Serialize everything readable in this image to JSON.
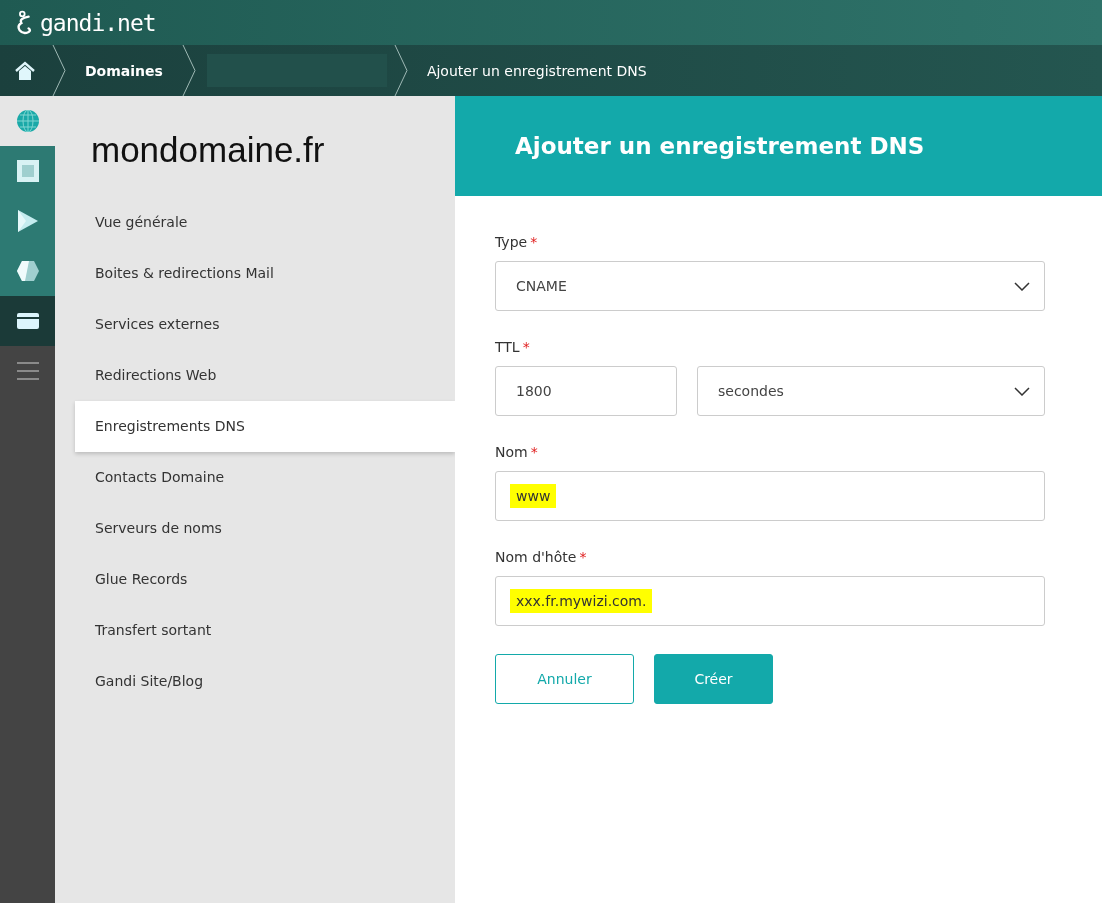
{
  "header": {
    "logo_text": "gandi.net"
  },
  "breadcrumb": [
    {
      "kind": "home"
    },
    {
      "kind": "text",
      "label": "Domaines",
      "bold": true
    },
    {
      "kind": "redacted"
    },
    {
      "kind": "text",
      "label": "Ajouter un enregistrement DNS",
      "bold": false
    }
  ],
  "sidebar": {
    "title": "mondomaine.fr",
    "items": [
      {
        "label": "Vue générale",
        "selected": false
      },
      {
        "label": "Boites & redirections Mail",
        "selected": false
      },
      {
        "label": "Services externes",
        "selected": false
      },
      {
        "label": "Redirections Web",
        "selected": false
      },
      {
        "label": "Enregistrements DNS",
        "selected": true
      },
      {
        "label": "Contacts Domaine",
        "selected": false
      },
      {
        "label": "Serveurs de noms",
        "selected": false
      },
      {
        "label": "Glue Records",
        "selected": false
      },
      {
        "label": "Transfert sortant",
        "selected": false
      },
      {
        "label": "Gandi Site/Blog",
        "selected": false
      }
    ]
  },
  "panel": {
    "title": "Ajouter un enregistrement DNS",
    "fields": [
      {
        "kind": "select",
        "label": "Type",
        "required_mark": "*",
        "value": "CNAME",
        "highlighted": false
      },
      {
        "kind": "pair",
        "label": "TTL",
        "required_mark": "*",
        "value": "1800",
        "unit": "secondes",
        "highlighted": false
      },
      {
        "kind": "input",
        "label": "Nom",
        "required_mark": "*",
        "value": "www",
        "highlighted": true
      },
      {
        "kind": "input",
        "label": "Nom d'hôte",
        "required_mark": "*",
        "value": "xxx.fr.mywizi.com.",
        "highlighted": true
      }
    ],
    "buttons": [
      {
        "kind": "secondary",
        "label": "Annuler"
      },
      {
        "kind": "primary",
        "label": "Créer"
      }
    ]
  }
}
